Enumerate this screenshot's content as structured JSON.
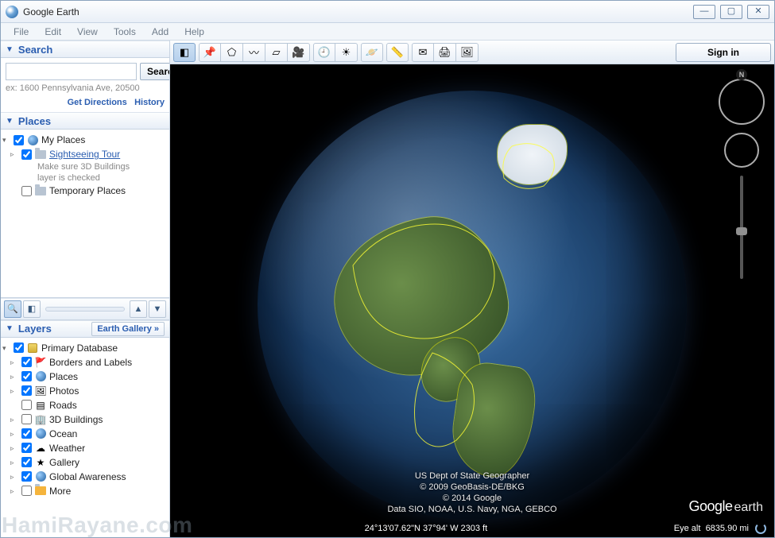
{
  "window": {
    "title": "Google Earth"
  },
  "menu": {
    "file": "File",
    "edit": "Edit",
    "view": "View",
    "tools": "Tools",
    "add": "Add",
    "help": "Help"
  },
  "search": {
    "title": "Search",
    "button": "Search",
    "hint": "ex: 1600 Pennsylvania Ave, 20500",
    "value": "",
    "get_directions": "Get Directions",
    "history": "History"
  },
  "places": {
    "title": "Places",
    "my_places": "My Places",
    "sightseeing": "Sightseeing Tour",
    "sightseeing_desc1": "Make sure 3D Buildings",
    "sightseeing_desc2": "layer is checked",
    "temporary": "Temporary Places"
  },
  "layers": {
    "title": "Layers",
    "earth_gallery": "Earth Gallery »",
    "primary_db": "Primary Database",
    "items": [
      {
        "label": "Borders and Labels",
        "checked": true,
        "icon": "flag"
      },
      {
        "label": "Places",
        "checked": true,
        "icon": "globe"
      },
      {
        "label": "Photos",
        "checked": true,
        "icon": "photo"
      },
      {
        "label": "Roads",
        "checked": false,
        "icon": "road"
      },
      {
        "label": "3D Buildings",
        "checked": false,
        "icon": "building"
      },
      {
        "label": "Ocean",
        "checked": true,
        "icon": "globe"
      },
      {
        "label": "Weather",
        "checked": true,
        "icon": "cloud"
      },
      {
        "label": "Gallery",
        "checked": true,
        "icon": "star"
      },
      {
        "label": "Global Awareness",
        "checked": true,
        "icon": "globe"
      },
      {
        "label": "More",
        "checked": false,
        "icon": "folder"
      }
    ]
  },
  "toolbar": {
    "signin": "Sign in"
  },
  "viewport": {
    "attrib1": "US Dept of State Geographer",
    "attrib2": "© 2009 GeoBasis-DE/BKG",
    "attrib3": "© 2014 Google",
    "attrib4": "Data SIO, NOAA, U.S. Navy, NGA, GEBCO",
    "coords": "24°13'07.62\"N  37°94' W  2303 ft",
    "eye_alt_label": "Eye alt",
    "eye_alt_value": "6835.90 mi",
    "compass_n": "N",
    "logo_main": "Google",
    "logo_sub": "earth"
  },
  "watermark": "HamiRayane.com"
}
